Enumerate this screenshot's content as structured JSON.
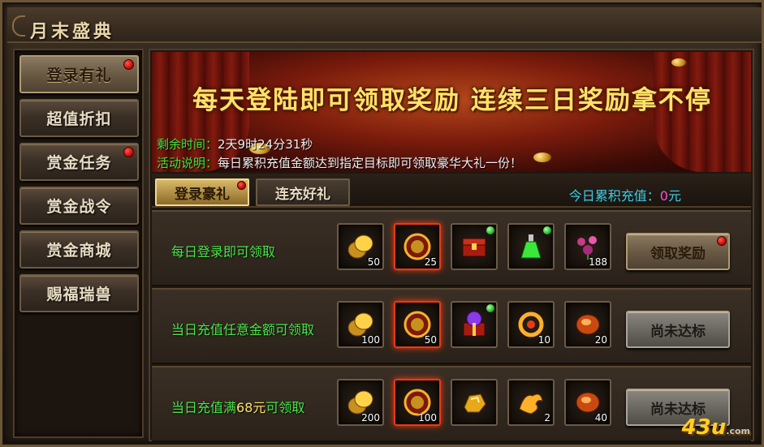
{
  "window": {
    "title": "月末盛典"
  },
  "sidebar": {
    "items": [
      {
        "label": "登录有礼",
        "active": true,
        "badge": true
      },
      {
        "label": "超值折扣",
        "active": false,
        "badge": false
      },
      {
        "label": "赏金任务",
        "active": false,
        "badge": true
      },
      {
        "label": "赏金战令",
        "active": false,
        "badge": false
      },
      {
        "label": "赏金商城",
        "active": false,
        "badge": false
      },
      {
        "label": "赐福瑞兽",
        "active": false,
        "badge": false
      }
    ]
  },
  "banner": {
    "headline": "每天登陆即可领取奖励 连续三日奖励拿不停",
    "time_label": "剩余时间：",
    "time_value": "2天9时24分31秒",
    "desc_label": "活动说明：",
    "desc_value": "每日累积充值金额达到指定目标即可领取豪华大礼一份！"
  },
  "tabs": [
    {
      "label": "登录豪礼",
      "active": true,
      "badge": true
    },
    {
      "label": "连充好礼",
      "active": false,
      "badge": false
    }
  ],
  "recharge": {
    "label": "今日累积充值：",
    "value": "0",
    "unit": "元"
  },
  "rows": [
    {
      "label": "每日登录即可领取",
      "button": "领取奖励",
      "button_state": "claimable",
      "items": [
        {
          "icon": "gold-coins-icon",
          "qty": "50",
          "rare": false,
          "dot": false
        },
        {
          "icon": "dragon-medal-icon",
          "qty": "25",
          "rare": true,
          "dot": false
        },
        {
          "icon": "treasure-chest-icon",
          "qty": "",
          "rare": false,
          "dot": true
        },
        {
          "icon": "green-potion-icon",
          "qty": "",
          "rare": false,
          "dot": true
        },
        {
          "icon": "flower-sprig-icon",
          "qty": "188",
          "rare": false,
          "dot": false
        }
      ]
    },
    {
      "label_prefix": "当日充值任意金额可领取",
      "label": "当日充值任意金额可领取",
      "button": "尚未达标",
      "button_state": "disabled",
      "items": [
        {
          "icon": "gold-coins-icon",
          "qty": "100",
          "rare": false,
          "dot": false
        },
        {
          "icon": "dragon-medal-icon",
          "qty": "50",
          "rare": true,
          "dot": false
        },
        {
          "icon": "purple-gift-box-icon",
          "qty": "",
          "rare": false,
          "dot": true
        },
        {
          "icon": "golden-ring-icon",
          "qty": "10",
          "rare": false,
          "dot": false
        },
        {
          "icon": "fire-stone-icon",
          "qty": "20",
          "rare": false,
          "dot": false
        }
      ]
    },
    {
      "label_prefix": "当日充值满",
      "label_num": "68元",
      "label_suffix": "可领取",
      "button": "尚未达标",
      "button_state": "disabled",
      "items": [
        {
          "icon": "gold-coins-icon",
          "qty": "200",
          "rare": false,
          "dot": false
        },
        {
          "icon": "dragon-medal-icon",
          "qty": "100",
          "rare": true,
          "dot": false
        },
        {
          "icon": "gold-ore-icon",
          "qty": "",
          "rare": false,
          "dot": false
        },
        {
          "icon": "golden-phoenix-icon",
          "qty": "2",
          "rare": false,
          "dot": false
        },
        {
          "icon": "fire-stone-icon",
          "qty": "40",
          "rare": false,
          "dot": false
        }
      ]
    }
  ],
  "watermark": {
    "text": "43u",
    "sub": ".com"
  }
}
